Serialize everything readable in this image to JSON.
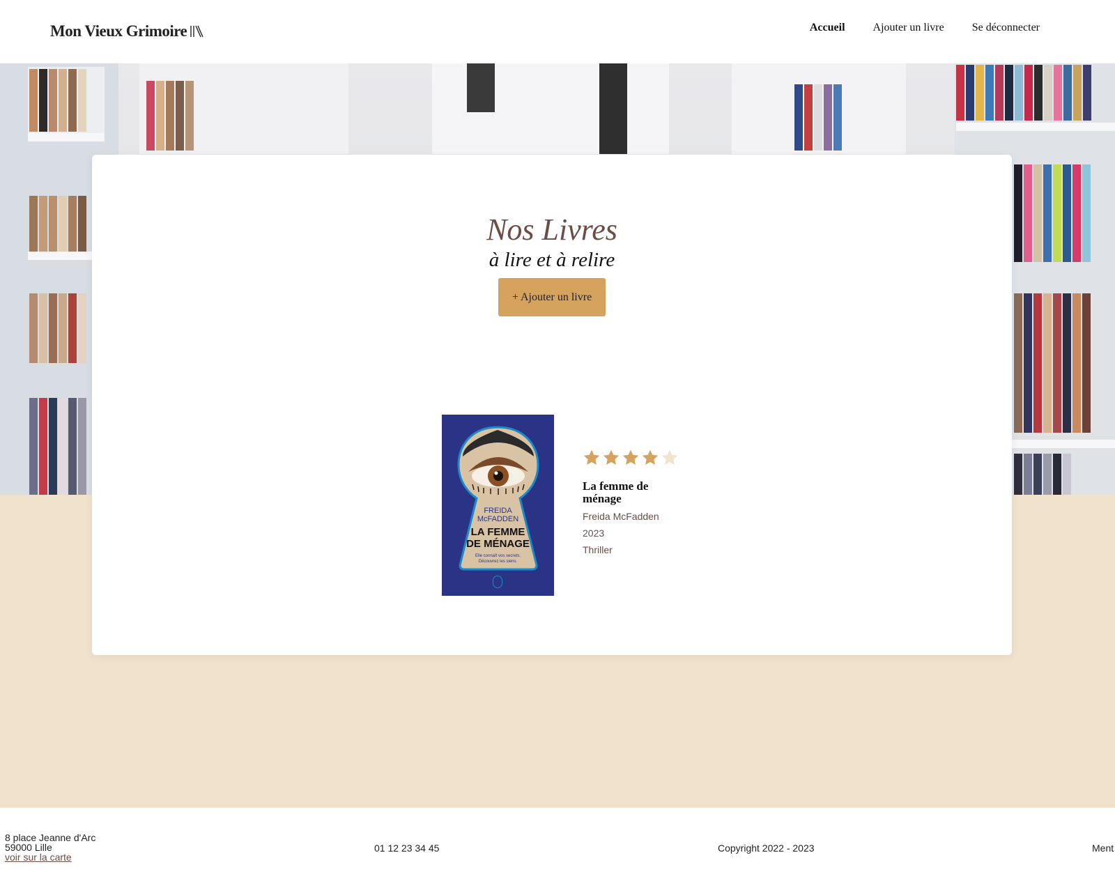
{
  "header": {
    "logo_text": "Mon Vieux Grimoire",
    "nav": [
      {
        "label": "Accueil",
        "active": true
      },
      {
        "label": "Ajouter un livre",
        "active": false
      },
      {
        "label": "Se déconnecter",
        "active": false
      }
    ]
  },
  "main": {
    "title": "Nos Livres",
    "subtitle": "à lire et à relire",
    "add_button_label": "+ Ajouter un livre"
  },
  "books": [
    {
      "title": "La femme de ménage",
      "author": "Freida McFadden",
      "year": "2023",
      "genre": "Thriller",
      "rating": 4,
      "rating_max": 5,
      "cover": {
        "author_text": "FREIDA McFADDEN",
        "title_line1": "LA FEMME",
        "title_line2": "DE MÉNAGE",
        "tagline1": "Elle connaît vos secrets.",
        "tagline2": "Découvrez les siens.",
        "publisher": "J'ai lu"
      }
    }
  ],
  "footer": {
    "address_line1": "8 place Jeanne d'Arc",
    "address_line2": "59000 Lille",
    "map_link": "voir sur la carte",
    "phone": "01 12 23 34 45",
    "copyright": "Copyright 2022 - 2023",
    "legal": "Ment"
  },
  "colors": {
    "accent": "#d6a35e",
    "brown": "#6b4d45",
    "beige": "#f1e2cd",
    "star_on": "#d6a35e",
    "star_off": "#f3e4cf",
    "badge_red": "#d92b1d"
  }
}
